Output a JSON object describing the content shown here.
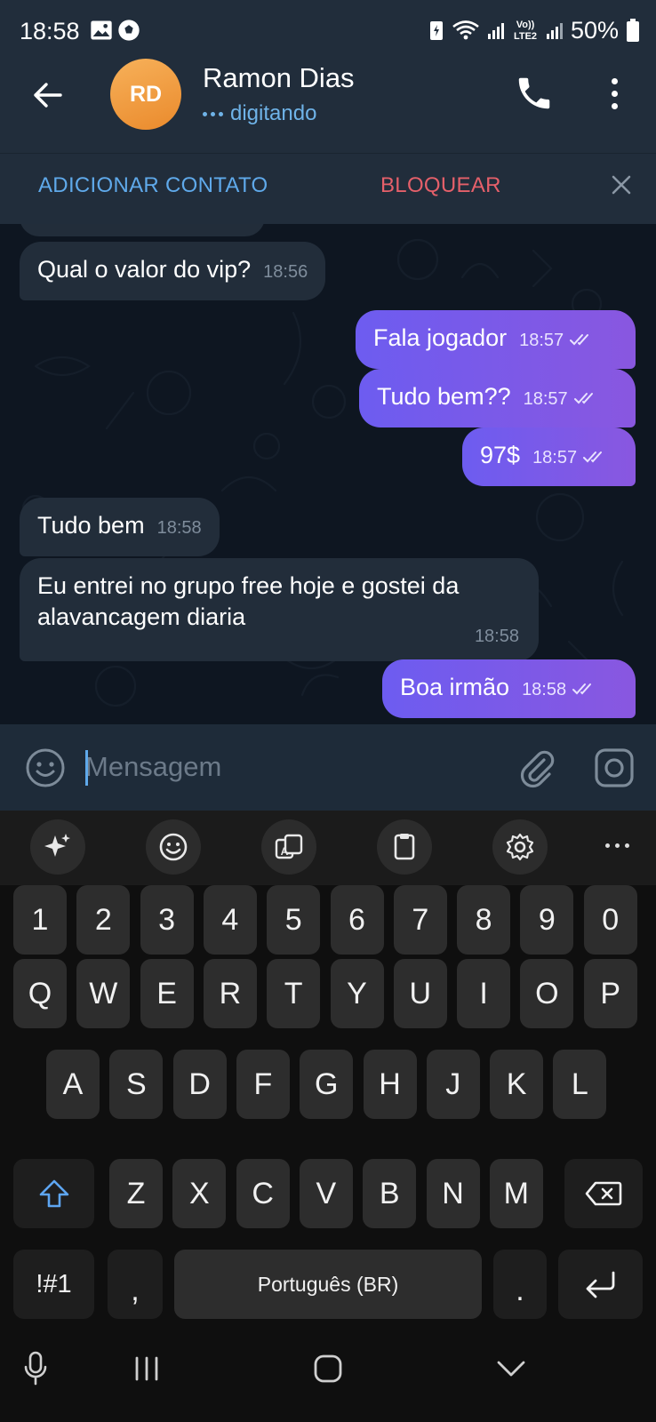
{
  "status_bar": {
    "time": "18:58",
    "battery": "50%",
    "icons": [
      "gallery-icon",
      "soccer-ball-icon",
      "battery-saver-icon",
      "wifi-icon",
      "signal-icon",
      "volte-icon",
      "signal-icon",
      "battery-icon"
    ]
  },
  "header": {
    "avatar_initials": "RD",
    "avatar_color": "#f0a042",
    "name": "Ramon Dias",
    "status": "digitando"
  },
  "action_bar": {
    "add_contact": "ADICIONAR CONTATO",
    "block": "BLOQUEAR"
  },
  "messages": [
    {
      "direction": "in",
      "text": "Qual o valor do vip?",
      "time": "18:56"
    },
    {
      "direction": "out",
      "text": "Fala jogador",
      "time": "18:57",
      "read": true
    },
    {
      "direction": "out",
      "text": "Tudo bem??",
      "time": "18:57",
      "read": true
    },
    {
      "direction": "out",
      "text": "97$",
      "time": "18:57",
      "read": true
    },
    {
      "direction": "in",
      "text": "Tudo bem",
      "time": "18:58"
    },
    {
      "direction": "in",
      "text": "Eu entrei no grupo free hoje e gostei da alavancagem diaria",
      "time": "18:58"
    },
    {
      "direction": "out",
      "text": "Boa irmão",
      "time": "18:58",
      "read": true
    }
  ],
  "input": {
    "placeholder": "Mensagem",
    "value": ""
  },
  "keyboard": {
    "toolbar": [
      "sparkle-ai-icon",
      "emoji-icon",
      "translate-icon",
      "clipboard-icon",
      "settings-icon",
      "more-icon"
    ],
    "row_numbers": [
      "1",
      "2",
      "3",
      "4",
      "5",
      "6",
      "7",
      "8",
      "9",
      "0"
    ],
    "row_1": [
      "Q",
      "W",
      "E",
      "R",
      "T",
      "Y",
      "U",
      "I",
      "O",
      "P"
    ],
    "row_2": [
      "A",
      "S",
      "D",
      "F",
      "G",
      "H",
      "J",
      "K",
      "L"
    ],
    "row_3": [
      "Z",
      "X",
      "C",
      "V",
      "B",
      "N",
      "M"
    ],
    "symbols_key": "!#1",
    "comma_key": ",",
    "space_label": "Português (BR)",
    "period_key": "."
  },
  "colors": {
    "header_bg": "#212d3b",
    "chat_bg": "#0e1621",
    "incoming_bubble": "#222d3a",
    "outgoing_bubble": "#7b5ae8",
    "link_blue": "#5fa9ea",
    "block_red": "#e5606a"
  }
}
